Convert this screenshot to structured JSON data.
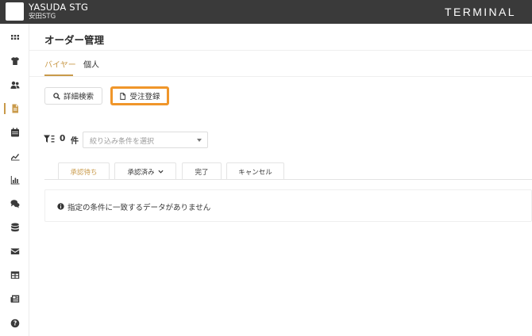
{
  "header": {
    "company_name": "YASUDA STG",
    "company_sub": "安田STG",
    "brand": "TERMINAL"
  },
  "sidebar": {
    "items": [
      {
        "icon": "grid-icon"
      },
      {
        "icon": "tshirt-icon"
      },
      {
        "icon": "users-icon"
      },
      {
        "icon": "document-icon",
        "active": true
      },
      {
        "icon": "calendar-icon"
      },
      {
        "icon": "trend-chart-icon"
      },
      {
        "icon": "bar-chart-icon"
      },
      {
        "icon": "chat-icon"
      },
      {
        "icon": "database-icon"
      },
      {
        "icon": "envelope-icon"
      },
      {
        "icon": "table-icon"
      },
      {
        "icon": "newspaper-icon"
      },
      {
        "icon": "help-icon"
      }
    ]
  },
  "page": {
    "title": "オーダー管理",
    "tabs": [
      {
        "label": "バイヤー",
        "active": true
      },
      {
        "label": "個人",
        "active": false
      }
    ]
  },
  "toolbar": {
    "search_label": "詳細検索",
    "register_label": "受注登録"
  },
  "filter": {
    "count": "0",
    "count_unit": "件",
    "select_placeholder": "絞り込み条件を選択"
  },
  "status_tabs": [
    {
      "label": "承認待ち",
      "active": true
    },
    {
      "label": "承認済み",
      "has_dropdown": true
    },
    {
      "label": "完了"
    },
    {
      "label": "キャンセル"
    }
  ],
  "empty_message": "指定の条件に一致するデータがありません",
  "colors": {
    "accent": "#c99a4a",
    "highlight": "#f0962a",
    "topbar": "#3a3a3a"
  }
}
